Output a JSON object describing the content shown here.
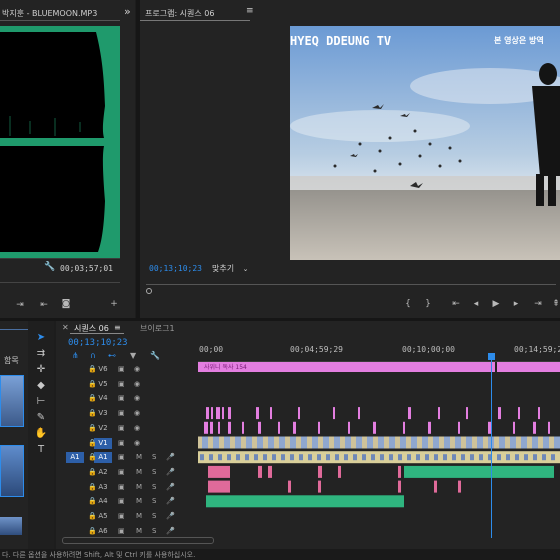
{
  "source_panel": {
    "title": "박지훈 - BLUEMOON.MP3",
    "timecode": "00;03;57;01",
    "menu_glyph": "»"
  },
  "program_panel": {
    "title": "프로그램: 시퀀스 06",
    "menu_glyph": "≡",
    "timecode": "00;13;10;23",
    "fit_label": "맞추기",
    "overlay_title": "HYEQ DDEUNG TV",
    "overlay_subtitle": "본 영상은 방역"
  },
  "timeline": {
    "tab_active": "시퀀스 06",
    "tab_menu": "≡",
    "tab_other": "브이로그1",
    "timecode": "00;13;10;23",
    "ruler": [
      "00;00",
      "00;04;59;29",
      "00;10;00;00",
      "00;14;59;29"
    ],
    "clip_title": "사위니 독사 154",
    "tracks": [
      "V6",
      "V5",
      "V4",
      "V3",
      "V2",
      "V1",
      "A1",
      "A2",
      "A3",
      "A4",
      "A5",
      "A6"
    ],
    "src_patch_v": "V1",
    "src_patch_a": "A1"
  },
  "project_panel": {
    "fragment_label": "함목"
  },
  "status_bar": {
    "text": "다. 다른 옵션을 사용하려면 Shift, Alt 및 Ctrl 키를 사용하십시오."
  },
  "colors": {
    "accent": "#2d8ceb",
    "waveform": "#1f9a6c",
    "video_clip": "#8fa7cf",
    "audio_clip": "#2fb57f",
    "title_clip": "#e37ee0",
    "pink_audio": "#e06a9a"
  }
}
